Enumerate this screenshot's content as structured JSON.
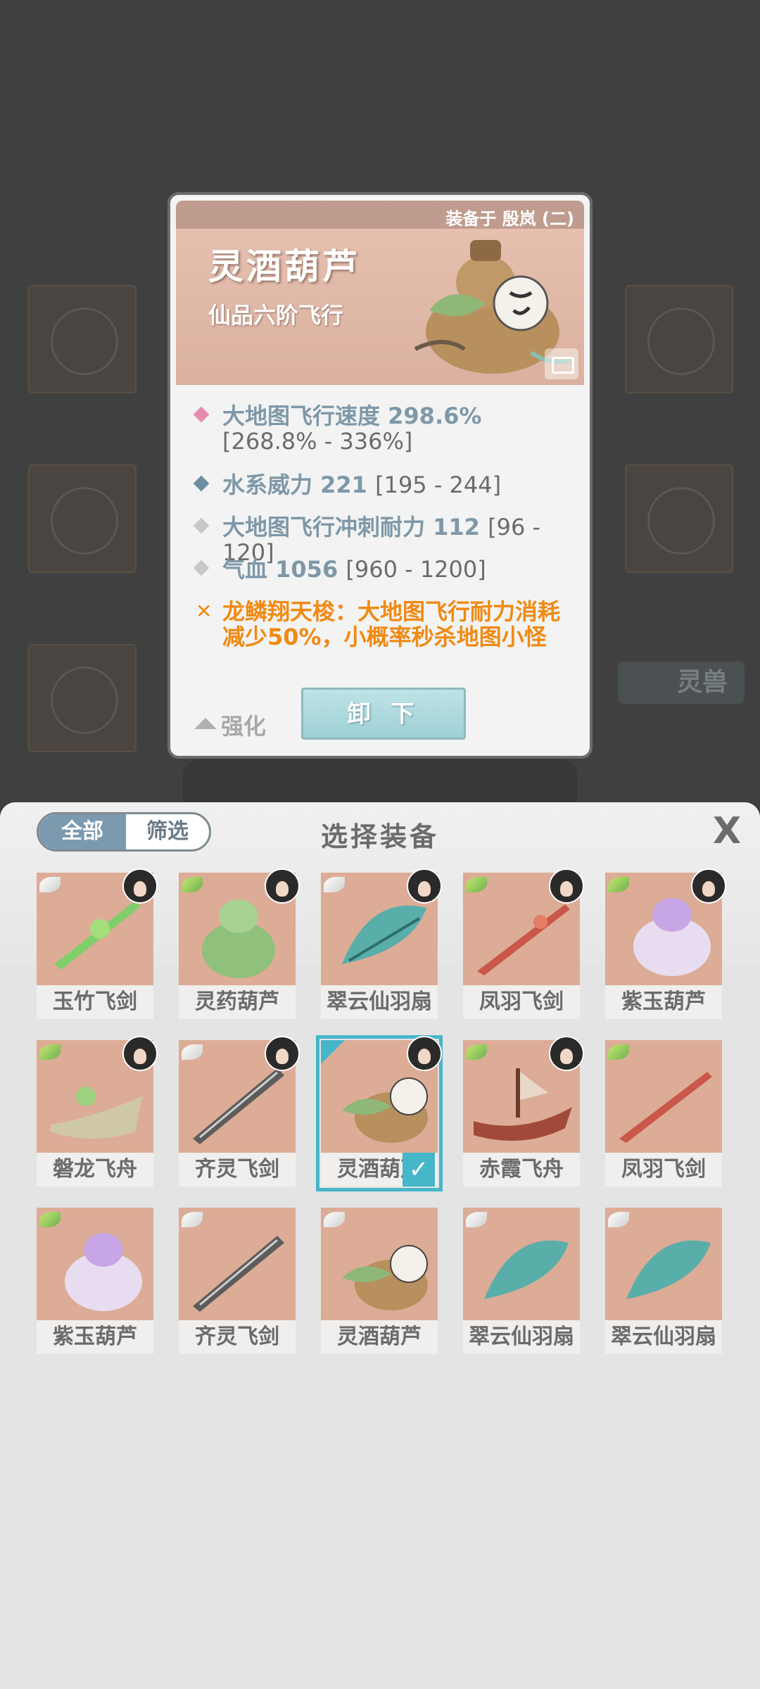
{
  "background": {
    "pet_button": "灵兽"
  },
  "detail": {
    "equipped_to": "装备于 殷岚 (二)",
    "name": "灵酒葫芦",
    "grade": "仙品六阶飞行",
    "stats": [
      {
        "label": "大地图飞行速度 298.6%",
        "range": "[268.8% - 336%]",
        "bullet_color": "#e58bb0"
      },
      {
        "label": "水系威力 221",
        "range": "[195 - 244]",
        "bullet_color": "#6d8ea3"
      },
      {
        "label": "大地图飞行冲刺耐力 112",
        "range": "[96 - 120]",
        "bullet_color": "#c8c8c8"
      },
      {
        "label": "气血 1056",
        "range": "[960 - 1200]",
        "bullet_color": "#c8c8c8"
      }
    ],
    "special": "龙鳞翔天梭：大地图飞行耐力消耗减少50%，小概率秒杀地图小怪",
    "enhance_label": "强化",
    "unequip_label": "卸 下"
  },
  "panel": {
    "tab_all": "全部",
    "tab_filter": "筛选",
    "title": "选择装备",
    "close": "X"
  },
  "items": [
    {
      "name": "玉竹飞剑",
      "wing": "white",
      "avatar": true,
      "tag": false
    },
    {
      "name": "灵药葫芦",
      "wing": "green",
      "avatar": true,
      "tag": true
    },
    {
      "name": "翠云仙羽扇",
      "wing": "white",
      "avatar": true,
      "tag": false
    },
    {
      "name": "凤羽飞剑",
      "wing": "green",
      "avatar": true,
      "tag": true
    },
    {
      "name": "紫玉葫芦",
      "wing": "green",
      "avatar": true,
      "tag": true
    },
    {
      "name": "磐龙飞舟",
      "wing": "green",
      "avatar": true,
      "tag": true
    },
    {
      "name": "齐灵飞剑",
      "wing": "white",
      "avatar": true,
      "tag": true
    },
    {
      "name": "灵酒葫芦",
      "wing": "none",
      "avatar": true,
      "tag": false,
      "selected": true
    },
    {
      "name": "赤霞飞舟",
      "wing": "green",
      "avatar": true,
      "tag": true
    },
    {
      "name": "凤羽飞剑",
      "wing": "green",
      "avatar": false,
      "tag": true
    },
    {
      "name": "紫玉葫芦",
      "wing": "green",
      "avatar": false,
      "tag": true
    },
    {
      "name": "齐灵飞剑",
      "wing": "white",
      "avatar": false,
      "tag": true
    },
    {
      "name": "灵酒葫芦",
      "wing": "white",
      "avatar": false,
      "tag": true
    },
    {
      "name": "翠云仙羽扇",
      "wing": "white",
      "avatar": false,
      "tag": false
    },
    {
      "name": "翠云仙羽扇",
      "wing": "white",
      "avatar": false,
      "tag": false
    }
  ],
  "colors": {
    "accent": "#46b6c9",
    "special_text": "#f08a12",
    "stat_text": "#7e98a8"
  }
}
